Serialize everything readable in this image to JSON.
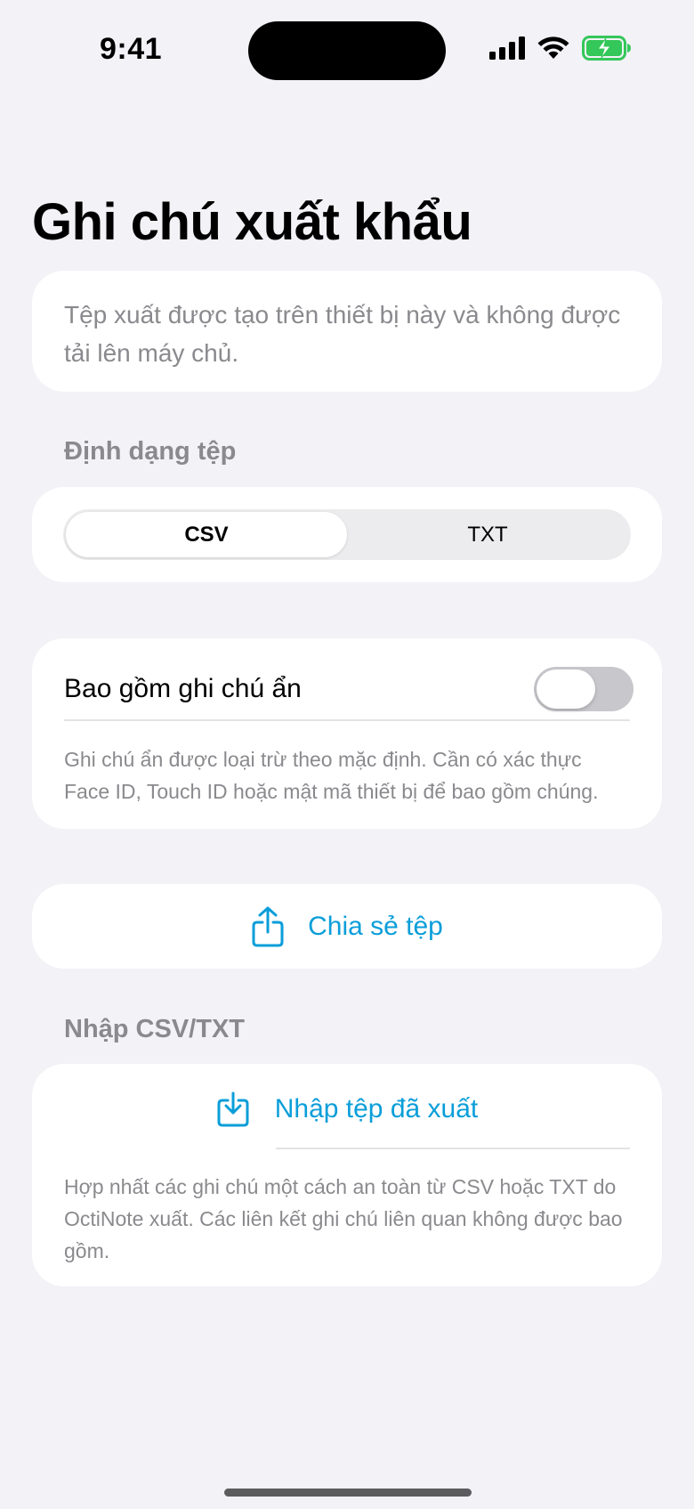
{
  "status_bar": {
    "time": "9:41",
    "icons": [
      "cellular-signal-icon",
      "wifi-icon",
      "battery-charging-icon"
    ]
  },
  "page": {
    "title": "Ghi chú xuất khẩu"
  },
  "info": {
    "text": "Tệp xuất được tạo trên thiết bị này và không được tải lên máy chủ."
  },
  "format": {
    "header": "Định dạng tệp",
    "options": [
      "CSV",
      "TXT"
    ],
    "selected": "CSV"
  },
  "hidden_notes": {
    "label": "Bao gồm ghi chú ẩn",
    "enabled": false,
    "footnote": "Ghi chú ẩn được loại trừ theo mặc định. Cần có xác thực Face ID, Touch ID hoặc mật mã thiết bị để bao gồm chúng."
  },
  "share": {
    "label": "Chia sẻ tệp",
    "icon": "share-icon"
  },
  "import": {
    "header": "Nhập CSV/TXT",
    "label": "Nhập tệp đã xuất",
    "icon": "import-icon",
    "footnote": "Hợp nhất các ghi chú một cách an toàn từ CSV hoặc TXT do OctiNote xuất. Các liên kết ghi chú liên quan không được bao gồm."
  },
  "colors": {
    "accent": "#0a9ed9",
    "background": "#f2f2f7",
    "secondary_text": "#8a8a8e",
    "battery_green": "#34c759"
  }
}
